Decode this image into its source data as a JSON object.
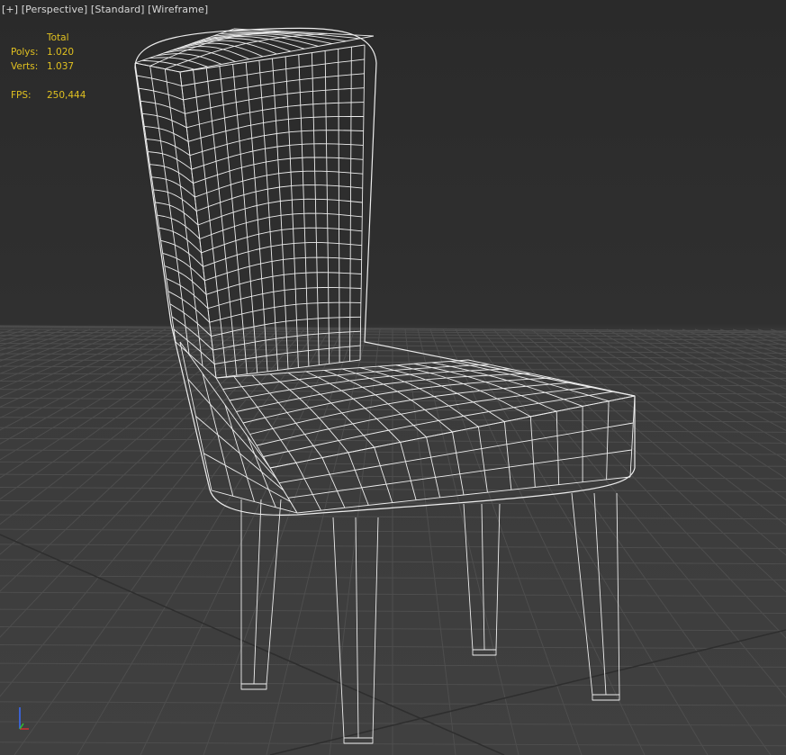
{
  "viewport_labels": {
    "plus": "[+]",
    "view": "[Perspective]",
    "shading_mode": "[Standard]",
    "display": "[Wireframe]"
  },
  "statistics": {
    "header": "Total",
    "polys_label": "Polys:",
    "polys_value": "1.020",
    "verts_label": "Verts:",
    "verts_value": "1.037",
    "fps_label": "FPS:",
    "fps_value": "250,444"
  },
  "axis_gizmo": {
    "x": "x",
    "y": "y",
    "z": "z"
  },
  "colors": {
    "background_top": "#2a2a2a",
    "ground": "#404040",
    "grid_line": "#555555",
    "wire": "#f0f0f0",
    "stats_text": "#e0c020",
    "label_text": "#d8d8d8"
  },
  "scene_object": {
    "name": "chair",
    "display": "wireframe"
  }
}
